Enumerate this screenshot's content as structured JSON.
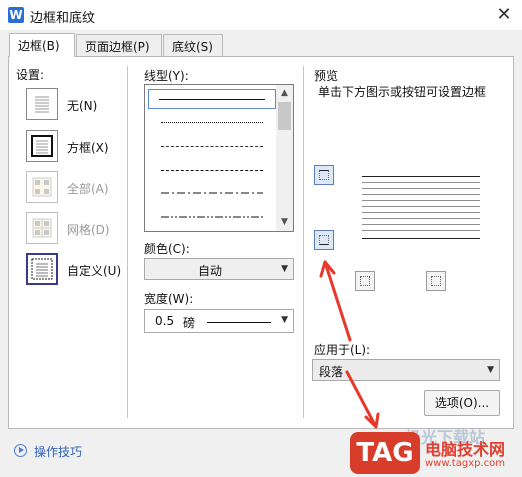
{
  "window": {
    "title": "边框和底纹",
    "close_glyph": "✕"
  },
  "tabs": [
    {
      "label": "边框(B)",
      "active": true
    },
    {
      "label": "页面边框(P)",
      "active": false
    },
    {
      "label": "底纹(S)",
      "active": false
    }
  ],
  "settings": {
    "label": "设置:",
    "items": [
      {
        "label": "无(N)",
        "enabled": true,
        "icon": "border-none-icon"
      },
      {
        "label": "方框(X)",
        "enabled": true,
        "icon": "border-box-icon"
      },
      {
        "label": "全部(A)",
        "enabled": false,
        "icon": "border-all-icon"
      },
      {
        "label": "网格(D)",
        "enabled": false,
        "icon": "border-grid-icon"
      },
      {
        "label": "自定义(U)",
        "enabled": true,
        "icon": "border-custom-icon"
      }
    ]
  },
  "line_style": {
    "label": "线型(Y):",
    "styles": [
      "solid",
      "dotted",
      "dashed-small",
      "dashed",
      "dash-dot",
      "dash-dot-dot"
    ],
    "selected_index": 0
  },
  "color": {
    "label": "颜色(C):",
    "value": "自动"
  },
  "width": {
    "label": "宽度(W):",
    "value": "0.5",
    "unit": "磅"
  },
  "preview": {
    "label": "预览",
    "hint": "单击下方图示或按钮可设置边框"
  },
  "apply_to": {
    "label": "应用于(L):",
    "value": "段落"
  },
  "options_button": {
    "label": "选项(O)..."
  },
  "tips": {
    "label": "操作技巧"
  },
  "watermark": {
    "logo": "TAG",
    "site_name": "电脑技术网",
    "url": "www.tagxp.com",
    "faint_text": "极光下载站"
  },
  "annotation": {
    "arrow_color": "#e8382a"
  },
  "colors": {
    "accent": "#2b6fd6",
    "link": "#2d62b8",
    "selection": "#5a8ad6"
  }
}
